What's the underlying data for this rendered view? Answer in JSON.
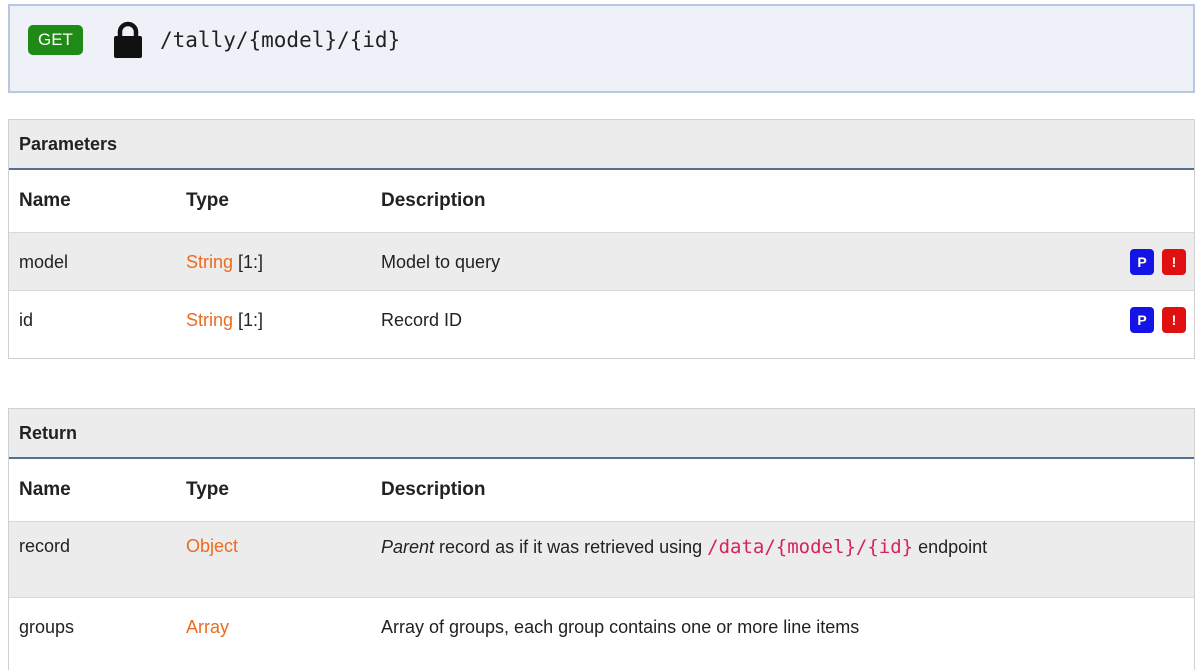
{
  "endpoint": {
    "method": "GET",
    "path": "/tally/{model}/{id}",
    "method_color": "#1f8a16",
    "icon": "lock-icon"
  },
  "parameters": {
    "title": "Parameters",
    "columns": [
      "Name",
      "Type",
      "Description"
    ],
    "rows": [
      {
        "name": "model",
        "type": "String",
        "type_suffix": " [1:]",
        "description": "Model to query",
        "tags": [
          "P",
          "!"
        ]
      },
      {
        "name": "id",
        "type": "String",
        "type_suffix": " [1:]",
        "description": "Record ID",
        "tags": [
          "P",
          "!"
        ]
      }
    ]
  },
  "return": {
    "title": "Return",
    "columns": [
      "Name",
      "Type",
      "Description"
    ],
    "rows": [
      {
        "name": "record",
        "type": "Object",
        "description_em": "Parent",
        "description_mid": " record as if it was retrieved using ",
        "description_code": "/data/{model}/{id}",
        "description_tail": " endpoint"
      },
      {
        "name": "groups",
        "type": "Array",
        "description": "Array of groups, each group contains one or more line items"
      }
    ]
  },
  "colors": {
    "type_link": "#ec6b1f",
    "tag_path": "#1414e6",
    "tag_required": "#e01010",
    "code": "#d6245a"
  }
}
